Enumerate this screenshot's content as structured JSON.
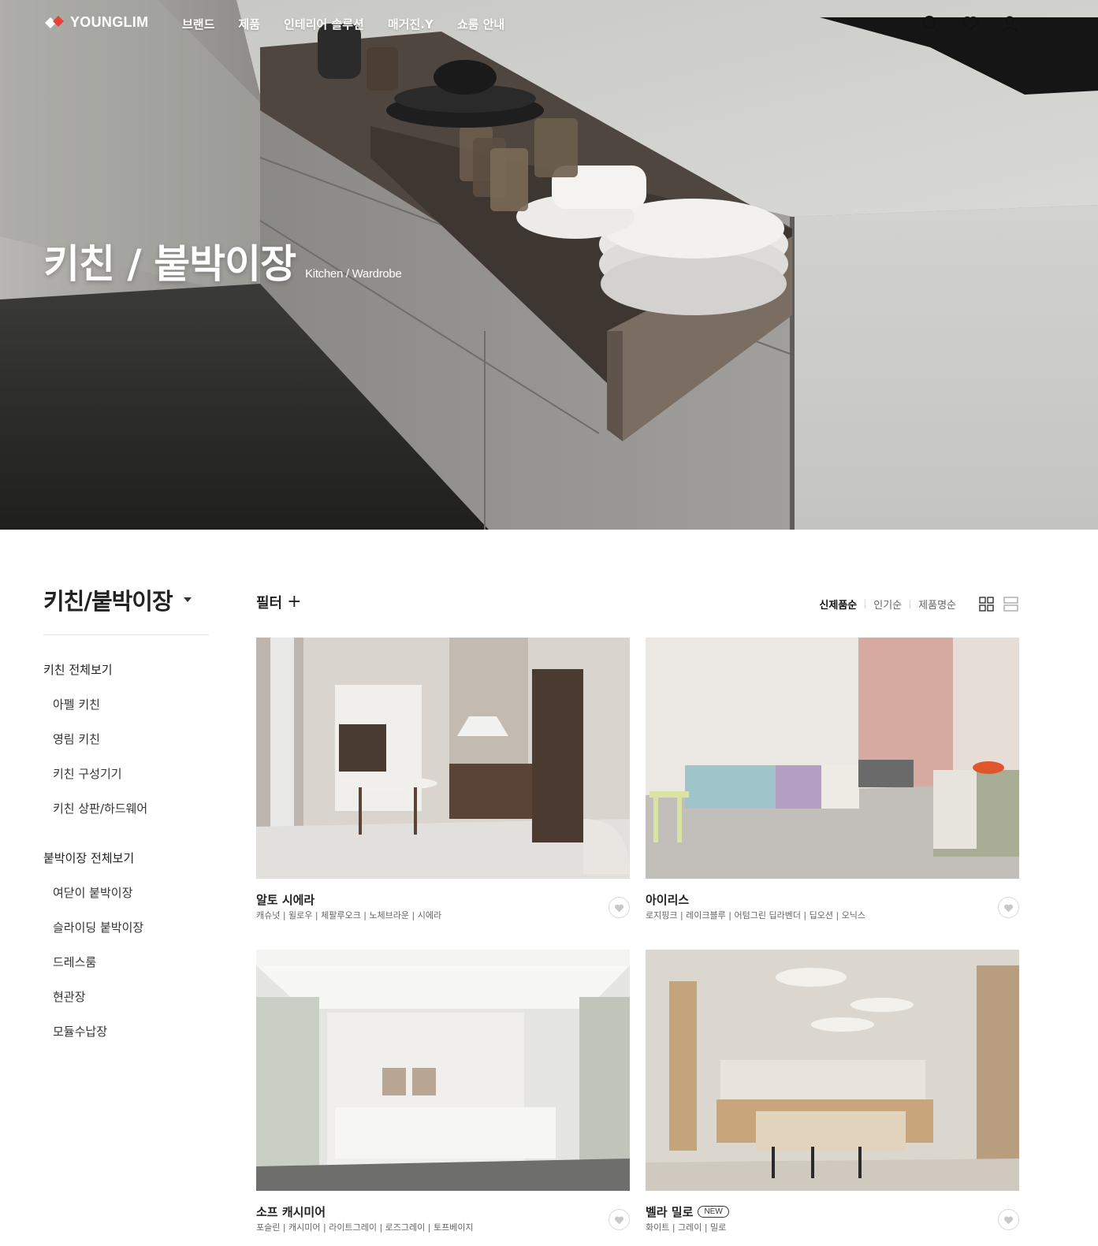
{
  "brand": {
    "name": "YOUNGLIM",
    "accent": "#e8403b"
  },
  "nav": {
    "items": [
      {
        "label": "브랜드"
      },
      {
        "label": "제품"
      },
      {
        "label": "인테리어 솔루션"
      },
      {
        "label": "매거진.Y"
      },
      {
        "label": "쇼룸 안내"
      }
    ],
    "icons": [
      "search-icon",
      "heart-icon",
      "user-icon"
    ]
  },
  "hero": {
    "title_ko": "키친 / 붙박이장",
    "title_en": "Kitchen / Wardrobe"
  },
  "sidebar": {
    "title": "키친/붙박이장",
    "groups": [
      {
        "label": "키친 전체보기",
        "items": [
          {
            "label": "아펠 키친"
          },
          {
            "label": "영림 키친"
          },
          {
            "label": "키친 구성기기"
          },
          {
            "label": "키친 상판/하드웨어"
          }
        ]
      },
      {
        "label": "붙박이장 전체보기",
        "items": [
          {
            "label": "여닫이 붙박이장"
          },
          {
            "label": "슬라이딩 붙박이장"
          },
          {
            "label": "드레스룸"
          },
          {
            "label": "현관장"
          },
          {
            "label": "모듈수납장"
          }
        ]
      }
    ]
  },
  "toolbar": {
    "filter_label": "필터",
    "filter_plus": "+",
    "sort": [
      {
        "label": "신제품순",
        "active": true
      },
      {
        "label": "인기순",
        "active": false
      },
      {
        "label": "제품명순",
        "active": false
      }
    ],
    "view_icons": [
      "grid-view-icon",
      "list-view-icon"
    ]
  },
  "products": [
    {
      "name": "알토 시에라",
      "colors": "캐슈넛 | 윌로우 | 체팔루오크 | 노체브라운 | 시에라",
      "is_new": false
    },
    {
      "name": "아이리스",
      "colors": "로지핑크 | 레이크블루 | 어텀그린 딥라벤더 | 딥오션 | 오닉스",
      "is_new": false
    },
    {
      "name": "소프 캐시미어",
      "colors": "포슬린 | 캐시미어 | 라이트그레이 | 로즈그레이 | 토프베이지",
      "is_new": false
    },
    {
      "name": "벨라 밀로",
      "colors": "화이트 | 그레이 | 밀로",
      "is_new": true,
      "badge": "NEW"
    }
  ]
}
